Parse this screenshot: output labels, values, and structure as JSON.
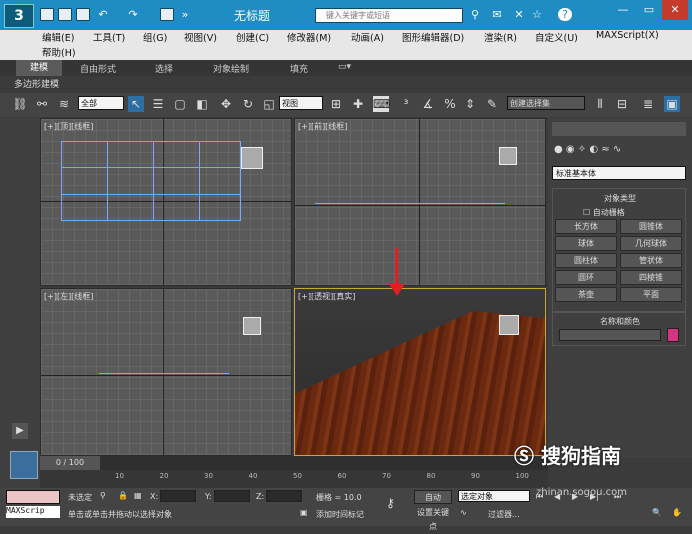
{
  "window": {
    "title": "无标题",
    "search_placeholder": "键入关键字或短语",
    "help_label": "?"
  },
  "menus": [
    "编辑(E)",
    "工具(T)",
    "组(G)",
    "视图(V)",
    "创建(C)",
    "修改器(M)",
    "动画(A)",
    "图形编辑器(D)",
    "渲染(R)",
    "自定义(U)",
    "MAXScript(X)",
    "帮助(H)"
  ],
  "ribbon": {
    "tabs": [
      "建模",
      "自由形式",
      "选择",
      "对象绘制",
      "填充"
    ],
    "active": "建模",
    "subtitle": "多边形建模"
  },
  "toolbar": {
    "filter": "全部",
    "ref_coord": "视图",
    "selection_set": "创建选择集"
  },
  "viewports": [
    {
      "label": "[+][顶][线框]"
    },
    {
      "label": "[+][前][线框]"
    },
    {
      "label": "[+][左][线框]"
    },
    {
      "label": "[+][透视][真实]"
    }
  ],
  "panel": {
    "category": "标准基本体",
    "rollout_title": "对象类型",
    "autogrid": "自动栅格",
    "objects": [
      "长方体",
      "圆锥体",
      "球体",
      "几何球体",
      "圆柱体",
      "管状体",
      "圆环",
      "四棱锥",
      "茶壶",
      "平面"
    ],
    "name_color": "名称和颜色",
    "color_swatch": "#d63384"
  },
  "timeline": {
    "frame": "0 / 100",
    "ticks": [
      "10",
      "20",
      "30",
      "40",
      "50",
      "60",
      "70",
      "80",
      "90",
      "100"
    ]
  },
  "status": {
    "selected": "未选定",
    "x_label": "X:",
    "y_label": "Y:",
    "z_label": "Z:",
    "grid": "栅格 = 10.0",
    "prompt": "单击或单击并拖动以选择对象",
    "add_time_tag": "添加时间标记",
    "auto": "自动",
    "key_dropdown": "选定对象",
    "set_key": "设置关键点",
    "filters": "过滤器...",
    "maxscript": "MAXScrip"
  },
  "watermark": {
    "text": "搜狗指南",
    "url": "zhinan.sogou.com"
  }
}
